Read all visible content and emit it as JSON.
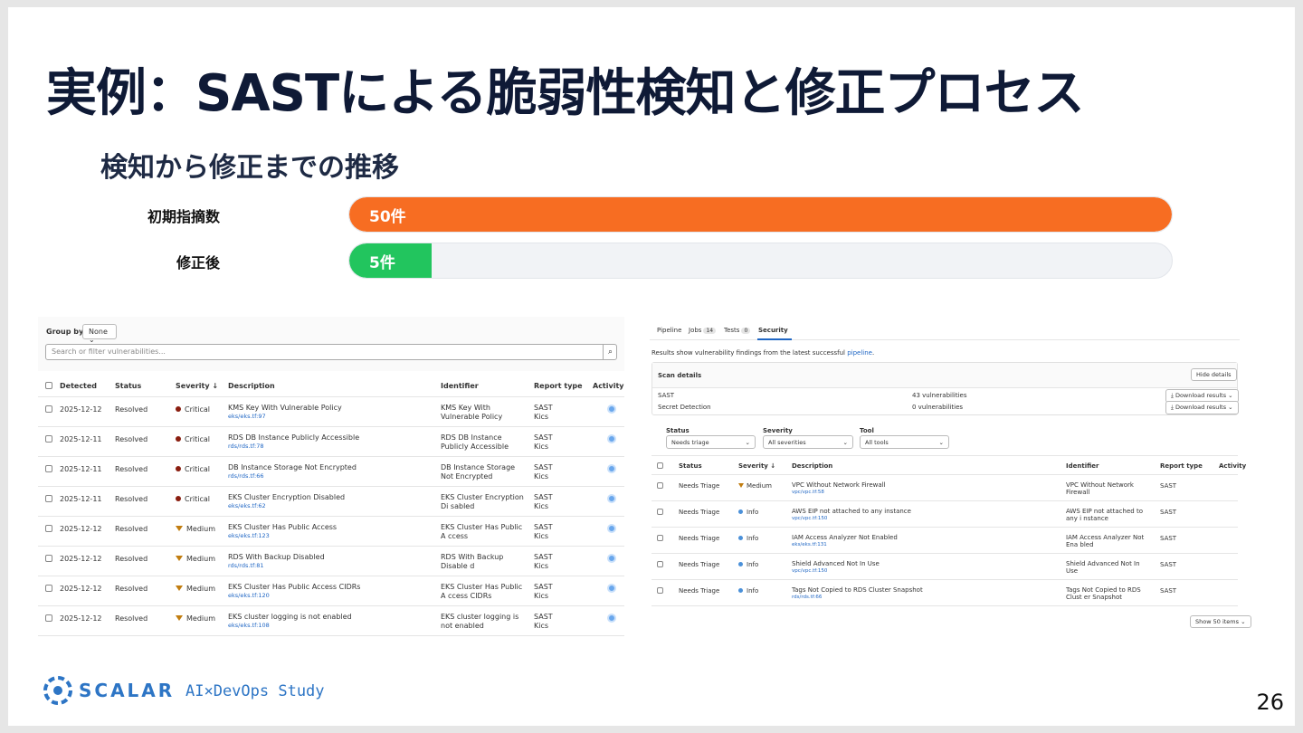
{
  "slide": {
    "title": "実例：SASTによる脆弱性検知と修正プロセス",
    "subtitle": "検知から修正までの推移",
    "page_number": "26"
  },
  "progress": {
    "rows": [
      {
        "label": "初期指摘数",
        "value_label": "50件",
        "fraction": 1.0,
        "color": "#f76d22"
      },
      {
        "label": "修正後",
        "value_label": "5件",
        "fraction": 0.1,
        "color": "#22c55e"
      }
    ]
  },
  "left_panel": {
    "group_by_label": "Group by:",
    "group_by_value": "None",
    "search_placeholder": "Search or filter vulnerabilities...",
    "columns": [
      "Detected",
      "Status",
      "Severity ↓",
      "Description",
      "Identifier",
      "Report type",
      "Activity"
    ],
    "rows": [
      {
        "detected": "2025-12-12",
        "status": "Resolved",
        "severity": "Critical",
        "desc": "KMS Key With Vulnerable Policy",
        "path": "eks/eks.tf:97",
        "identifier": "KMS Key With Vulnerable Policy",
        "report": "SAST",
        "tool": "Kics"
      },
      {
        "detected": "2025-12-11",
        "status": "Resolved",
        "severity": "Critical",
        "desc": "RDS DB Instance Publicly Accessible",
        "path": "rds/rds.tf:78",
        "identifier": "RDS DB Instance Publicly Accessible",
        "report": "SAST",
        "tool": "Kics"
      },
      {
        "detected": "2025-12-11",
        "status": "Resolved",
        "severity": "Critical",
        "desc": "DB Instance Storage Not Encrypted",
        "path": "rds/rds.tf:66",
        "identifier": "DB Instance Storage Not Encrypted",
        "report": "SAST",
        "tool": "Kics"
      },
      {
        "detected": "2025-12-11",
        "status": "Resolved",
        "severity": "Critical",
        "desc": "EKS Cluster Encryption Disabled",
        "path": "eks/eks.tf:62",
        "identifier": "EKS Cluster Encryption Di sabled",
        "report": "SAST",
        "tool": "Kics"
      },
      {
        "detected": "2025-12-12",
        "status": "Resolved",
        "severity": "Medium",
        "desc": "EKS Cluster Has Public Access",
        "path": "eks/eks.tf:123",
        "identifier": "EKS Cluster Has Public A ccess",
        "report": "SAST",
        "tool": "Kics"
      },
      {
        "detected": "2025-12-12",
        "status": "Resolved",
        "severity": "Medium",
        "desc": "RDS With Backup Disabled",
        "path": "rds/rds.tf:81",
        "identifier": "RDS With Backup Disable d",
        "report": "SAST",
        "tool": "Kics"
      },
      {
        "detected": "2025-12-12",
        "status": "Resolved",
        "severity": "Medium",
        "desc": "EKS Cluster Has Public Access CIDRs",
        "path": "eks/eks.tf:120",
        "identifier": "EKS Cluster Has Public A ccess CIDRs",
        "report": "SAST",
        "tool": "Kics"
      },
      {
        "detected": "2025-12-12",
        "status": "Resolved",
        "severity": "Medium",
        "desc": "EKS cluster logging is not enabled",
        "path": "eks/eks.tf:108",
        "identifier": "EKS cluster logging is not enabled",
        "report": "SAST",
        "tool": "Kics"
      }
    ]
  },
  "right_panel": {
    "tabs": [
      {
        "label": "Pipeline",
        "badge": ""
      },
      {
        "label": "Jobs",
        "badge": "14"
      },
      {
        "label": "Tests",
        "badge": "0"
      },
      {
        "label": "Security",
        "badge": ""
      }
    ],
    "info_text": "Results show vulnerability findings from the latest successful ",
    "info_link": "pipeline",
    "info_end": ".",
    "scan_details_title": "Scan details",
    "hide_details": "Hide details",
    "scans": [
      {
        "name": "SAST",
        "count": "43 vulnerabilities",
        "action": "Download results"
      },
      {
        "name": "Secret Detection",
        "count": "0 vulnerabilities",
        "action": "Download results"
      }
    ],
    "filters": [
      {
        "label": "Status",
        "value": "Needs triage"
      },
      {
        "label": "Severity",
        "value": "All severities"
      },
      {
        "label": "Tool",
        "value": "All tools"
      }
    ],
    "columns": [
      "Status",
      "Severity ↓",
      "Description",
      "Identifier",
      "Report type",
      "Activity"
    ],
    "rows": [
      {
        "status": "Needs Triage",
        "severity": "Medium",
        "desc": "VPC Without Network Firewall",
        "path": "vpc/vpc.tf:58",
        "identifier": "VPC Without Network Firewall",
        "report": "SAST"
      },
      {
        "status": "Needs Triage",
        "severity": "Info",
        "desc": "AWS EIP not attached to any instance",
        "path": "vpc/vpc.tf:150",
        "identifier": "AWS EIP not attached to any i nstance",
        "report": "SAST"
      },
      {
        "status": "Needs Triage",
        "severity": "Info",
        "desc": "IAM Access Analyzer Not Enabled",
        "path": "eks/eks.tf:131",
        "identifier": "IAM Access Analyzer Not Ena bled",
        "report": "SAST"
      },
      {
        "status": "Needs Triage",
        "severity": "Info",
        "desc": "Shield Advanced Not In Use",
        "path": "vpc/vpc.tf:150",
        "identifier": "Shield Advanced Not In Use",
        "report": "SAST"
      },
      {
        "status": "Needs Triage",
        "severity": "Info",
        "desc": "Tags Not Copied to RDS Cluster Snapshot",
        "path": "rds/rds.tf:66",
        "identifier": "Tags Not Copied to RDS Clust er Snapshot",
        "report": "SAST"
      }
    ],
    "show_items": "Show 50 items"
  },
  "footer": {
    "brand": "SCALAR",
    "tagline": "AI×DevOps Study"
  }
}
